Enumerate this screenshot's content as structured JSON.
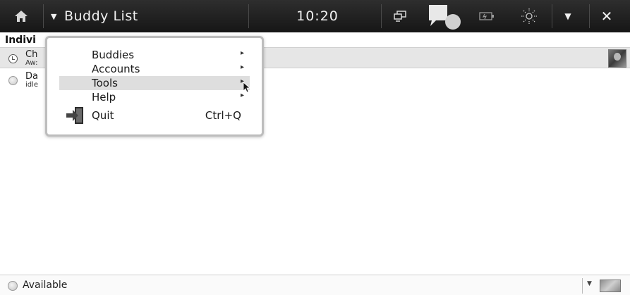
{
  "topbar": {
    "home_icon": "home-icon",
    "title": "Buddy List",
    "title_arrow": "▼",
    "clock": "10:20",
    "icons": [
      "network-icon",
      "chat-bubble-icon",
      "battery-icon",
      "brightness-icon"
    ],
    "menu_arrow": "▼",
    "close_label": "✕"
  },
  "buddy_list": {
    "group_header": "Indivi",
    "buddies": [
      {
        "name": "Ch",
        "status_text": "Aw:",
        "status": "away",
        "selected": true
      },
      {
        "name": "Da",
        "status_text": "idle",
        "status": "idle",
        "selected": false
      }
    ]
  },
  "menu": {
    "items": [
      {
        "label": "Buddies",
        "submenu_arrow": "▸"
      },
      {
        "label": "Accounts",
        "submenu_arrow": "▸"
      },
      {
        "label": "Tools",
        "submenu_arrow": "▸",
        "highlighted": true
      },
      {
        "label": "Help",
        "submenu_arrow": "▸"
      }
    ],
    "quit": {
      "label": "Quit",
      "accelerator": "Ctrl+Q"
    }
  },
  "statusbar": {
    "status_label": "Available",
    "dropdown_arrow": "▼"
  },
  "colors": {
    "topbar_bg": "#1e1e1e",
    "highlight": "#dedede",
    "selected_row": "#e6e6e6"
  }
}
